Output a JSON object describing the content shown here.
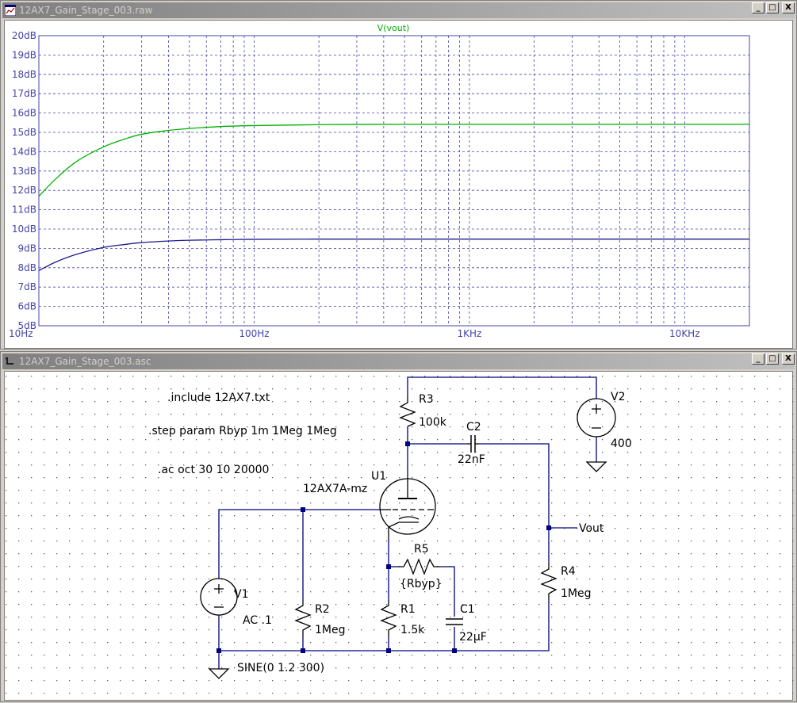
{
  "waveform_window": {
    "title": "12AX7_Gain_Stage_003.raw",
    "trace_label": "V(vout)",
    "y_ticks": [
      "20dB",
      "19dB",
      "18dB",
      "17dB",
      "16dB",
      "15dB",
      "14dB",
      "13dB",
      "12dB",
      "11dB",
      "10dB",
      "9dB",
      "8dB",
      "7dB",
      "6dB",
      "5dB"
    ],
    "x_ticks": [
      "10Hz",
      "100Hz",
      "1KHz",
      "10KHz"
    ]
  },
  "schematic_window": {
    "title": "12AX7_Gain_Stage_003.asc",
    "directives": [
      ".include 12AX7.txt",
      ".step param Rbyp 1m 1Meg 1Meg",
      ".ac oct 30 10 20000"
    ],
    "components": {
      "u1": {
        "ref": "U1",
        "value": "12AX7A-mz"
      },
      "r1": {
        "ref": "R1",
        "value": "1.5k"
      },
      "r2": {
        "ref": "R2",
        "value": "1Meg"
      },
      "r3": {
        "ref": "R3",
        "value": "100k"
      },
      "r4": {
        "ref": "R4",
        "value": "1Meg"
      },
      "r5": {
        "ref": "R5",
        "value": "{Rbyp}"
      },
      "c1": {
        "ref": "C1",
        "value": "22µF"
      },
      "c2": {
        "ref": "C2",
        "value": "22nF"
      },
      "v1": {
        "ref": "V1",
        "value": "AC .1",
        "extra": "SINE(0 1.2 300)"
      },
      "v2": {
        "ref": "V2",
        "value": "400"
      }
    },
    "net_label": "Vout"
  },
  "window_buttons": {
    "minimize": "_",
    "maximize": "□",
    "close": "X"
  },
  "colors": {
    "green_trace": "#00b000",
    "blue_trace": "#1a1a8c",
    "grid": "#4444aa",
    "background": "#ffffff",
    "wire": "#000080",
    "component": "#000000"
  },
  "chart_data": {
    "type": "line",
    "title": "V(vout)",
    "xscale": "log",
    "xlim": [
      10,
      20000
    ],
    "ylim": [
      5,
      20
    ],
    "grid": true,
    "series": [
      {
        "color": "#00b000",
        "x": [
          10,
          12,
          15,
          20,
          25,
          30,
          40,
          50,
          70,
          100,
          200,
          500,
          1000,
          5000,
          20000
        ],
        "y": [
          11.7,
          12.6,
          13.5,
          14.25,
          14.65,
          14.9,
          15.1,
          15.2,
          15.3,
          15.35,
          15.4,
          15.42,
          15.42,
          15.42,
          15.42
        ]
      },
      {
        "color": "#1a1a8c",
        "x": [
          10,
          12,
          15,
          20,
          25,
          30,
          40,
          50,
          70,
          100,
          200,
          500,
          1000,
          5000,
          20000
        ],
        "y": [
          7.85,
          8.3,
          8.7,
          9.05,
          9.2,
          9.3,
          9.38,
          9.42,
          9.45,
          9.47,
          9.48,
          9.48,
          9.48,
          9.48,
          9.48
        ]
      }
    ]
  }
}
